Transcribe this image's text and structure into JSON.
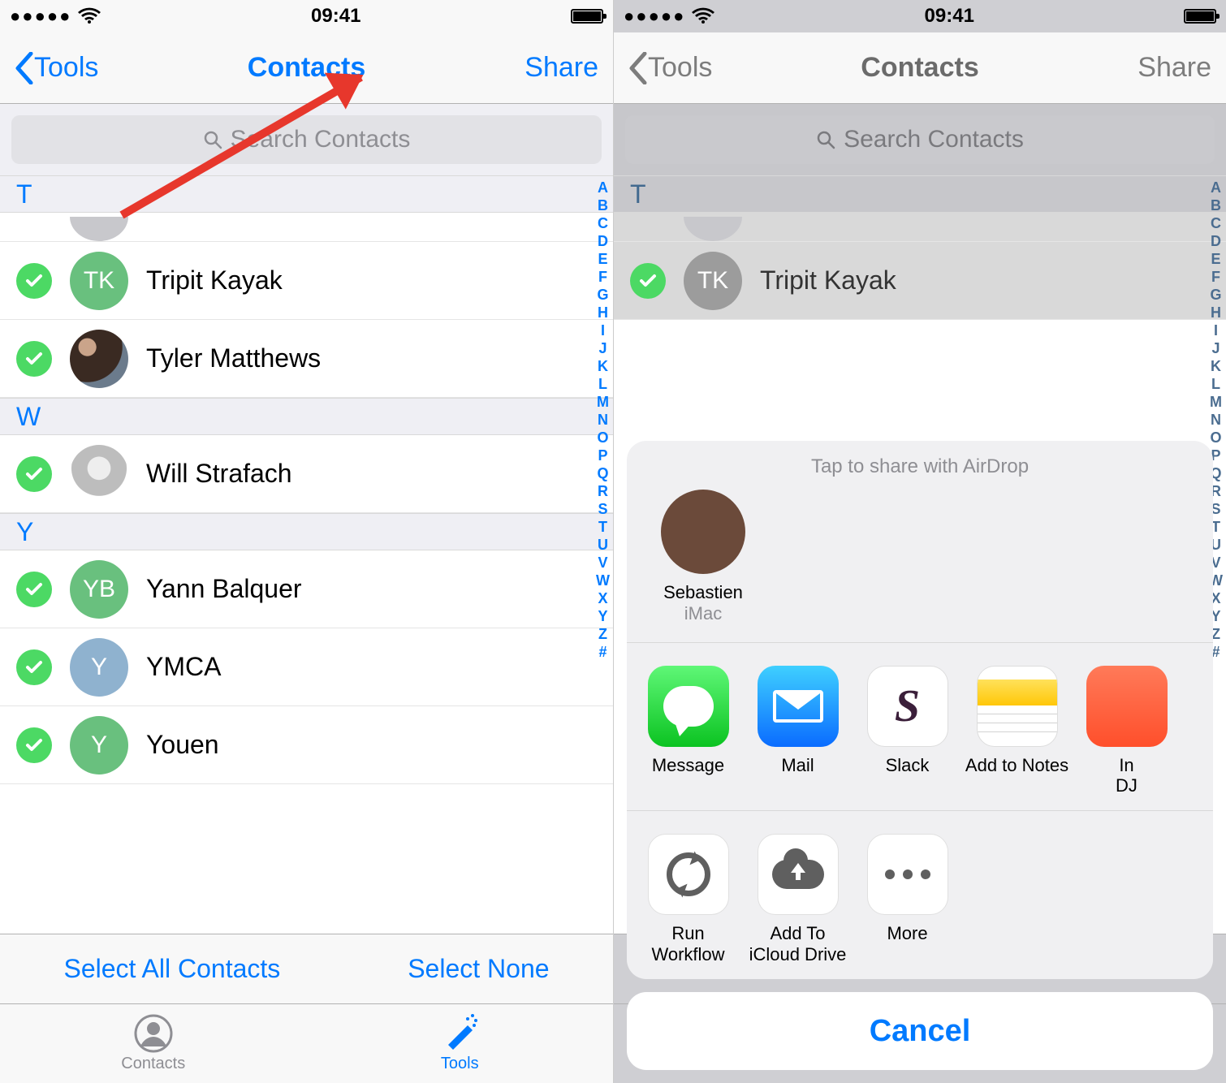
{
  "status": {
    "time": "09:41"
  },
  "nav": {
    "back": "Tools",
    "title": "Contacts",
    "share": "Share"
  },
  "search": {
    "placeholder": "Search Contacts"
  },
  "sections": [
    {
      "letter": "T",
      "rows": [
        {
          "name": "Tripit Kayak",
          "initials": "TK",
          "avatar_color": "#69c07e",
          "photo": false
        },
        {
          "name": "Tyler Matthews",
          "initials": "",
          "avatar_color": "",
          "photo": "photo1"
        }
      ]
    },
    {
      "letter": "W",
      "rows": [
        {
          "name": "Will Strafach",
          "initials": "",
          "avatar_color": "",
          "photo": "photo2"
        }
      ]
    },
    {
      "letter": "Y",
      "rows": [
        {
          "name": "Yann Balquer",
          "initials": "YB",
          "avatar_color": "#69c07e",
          "photo": false
        },
        {
          "name": "YMCA",
          "initials": "Y",
          "avatar_color": "#8fb2cf",
          "photo": false
        },
        {
          "name": "Youen",
          "initials": "Y",
          "avatar_color": "#69c07e",
          "photo": false
        }
      ]
    }
  ],
  "index_letters": [
    "A",
    "B",
    "C",
    "D",
    "E",
    "F",
    "G",
    "H",
    "I",
    "J",
    "K",
    "L",
    "M",
    "N",
    "O",
    "P",
    "Q",
    "R",
    "S",
    "T",
    "U",
    "V",
    "W",
    "X",
    "Y",
    "Z",
    "#"
  ],
  "selectbar": {
    "all": "Select All Contacts",
    "none": "Select None"
  },
  "tabs": {
    "contacts": "Contacts",
    "tools": "Tools"
  },
  "sheet": {
    "airdrop_title": "Tap to share with AirDrop",
    "airdrop": [
      {
        "name": "Sebastien",
        "sub": "iMac"
      }
    ],
    "apps": [
      {
        "label": "Message",
        "icon": "msg"
      },
      {
        "label": "Mail",
        "icon": "mail"
      },
      {
        "label": "Slack",
        "icon": "slack"
      },
      {
        "label": "Add to Notes",
        "icon": "notes"
      }
    ],
    "apps_overflow": [
      "In",
      "DJ"
    ],
    "actions": [
      {
        "label": "Run Workflow",
        "icon": "sync"
      },
      {
        "label": "Add To iCloud Drive",
        "icon": "cloud"
      },
      {
        "label": "More",
        "icon": "more"
      }
    ],
    "cancel": "Cancel"
  }
}
